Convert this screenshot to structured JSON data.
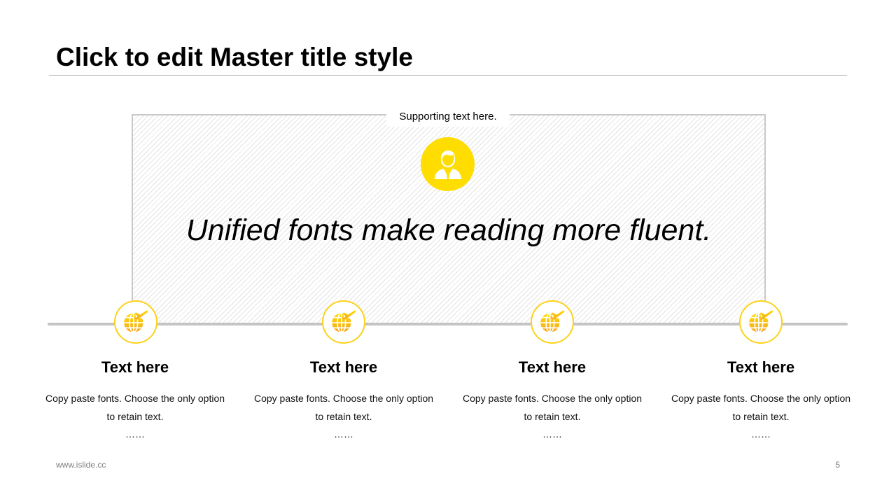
{
  "slide": {
    "title": "Click to edit Master title style",
    "supporting_text": "Supporting text here.",
    "headline": "Unified fonts make reading more fluent.",
    "hero_icon": "person-icon",
    "accent_color": "#FFDD00",
    "accent_gradient_end": "#F5A623",
    "timeline_color": "#C4C4C4",
    "items": [
      {
        "icon": "globe-plane-icon",
        "title": "Text here",
        "description": "Copy paste fonts. Choose the only option to retain text.",
        "ellipsis": "……"
      },
      {
        "icon": "globe-plane-icon",
        "title": "Text here",
        "description": "Copy paste fonts. Choose the only option to retain text.",
        "ellipsis": "……"
      },
      {
        "icon": "globe-plane-icon",
        "title": "Text here",
        "description": "Copy paste fonts. Choose the only option to retain text.",
        "ellipsis": "……"
      },
      {
        "icon": "globe-plane-icon",
        "title": "Text here",
        "description": "Copy paste fonts. Choose the only option to retain text.",
        "ellipsis": "……"
      }
    ]
  },
  "footer": {
    "url": "www.islide.cc",
    "page_number": "5"
  }
}
